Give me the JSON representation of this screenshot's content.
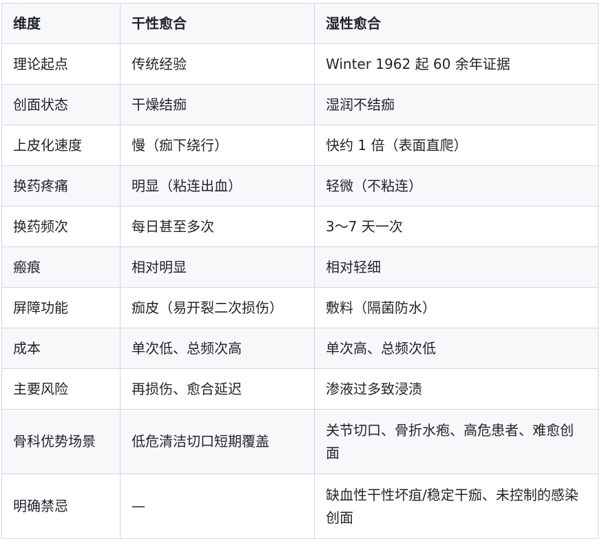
{
  "table": {
    "headers": [
      "维度",
      "干性愈合",
      "湿性愈合"
    ],
    "rows": [
      [
        "理论起点",
        "传统经验",
        "Winter 1962 起 60 余年证据"
      ],
      [
        "创面状态",
        "干燥结痂",
        "湿润不结痂"
      ],
      [
        "上皮化速度",
        "慢（痂下绕行）",
        "快约 1 倍（表面直爬）"
      ],
      [
        "换药疼痛",
        "明显（粘连出血）",
        "轻微（不粘连）"
      ],
      [
        "换药频次",
        "每日甚至多次",
        "3～7 天一次"
      ],
      [
        "瘢痕",
        "相对明显",
        "相对轻细"
      ],
      [
        "屏障功能",
        "痂皮（易开裂二次损伤）",
        "敷料（隔菌防水）"
      ],
      [
        "成本",
        "单次低、总频次高",
        "单次高、总频次低"
      ],
      [
        "主要风险",
        "再损伤、愈合延迟",
        "渗液过多致浸渍"
      ],
      [
        "骨科优势场景",
        "低危清洁切口短期覆盖",
        "关节切口、骨折水疱、高危患者、难愈创面"
      ],
      [
        "明确禁忌",
        "—",
        "缺血性干性坏疽/稳定干痂、未控制的感染创面"
      ]
    ]
  }
}
